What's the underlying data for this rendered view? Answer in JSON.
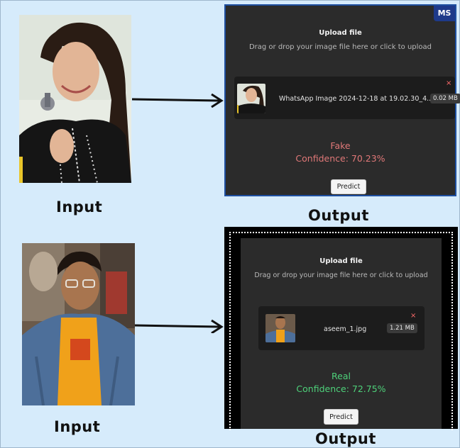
{
  "top": {
    "input_caption": "Input",
    "output_caption": "Output",
    "badge": "MS",
    "panel": {
      "title": "Upload file",
      "subtitle": "Drag or drop your image file here or click to upload",
      "file_name": "WhatsApp Image 2024-12-18 at 19.02.30_4...",
      "file_size": "0.02 MB",
      "close_icon": "×",
      "result_label": "Fake",
      "confidence": "Confidence: 70.23%",
      "result_color": "#e07878",
      "predict_label": "Predict"
    }
  },
  "bottom": {
    "input_caption": "Input",
    "output_caption": "Output",
    "panel": {
      "title": "Upload file",
      "subtitle": "Drag or drop your image file here or click to upload",
      "file_name": "aseem_1.jpg",
      "file_size": "1.21 MB",
      "close_icon": "×",
      "result_label": "Real",
      "confidence": "Confidence: 72.75%",
      "result_color": "#4ed17a",
      "predict_label": "Predict"
    }
  },
  "colors": {
    "page_bg": "#d6ebfb",
    "panel_bg": "#2b2b2b",
    "panel_border_top": "#1e4fa0",
    "badge_bg": "#1e3a8a"
  }
}
